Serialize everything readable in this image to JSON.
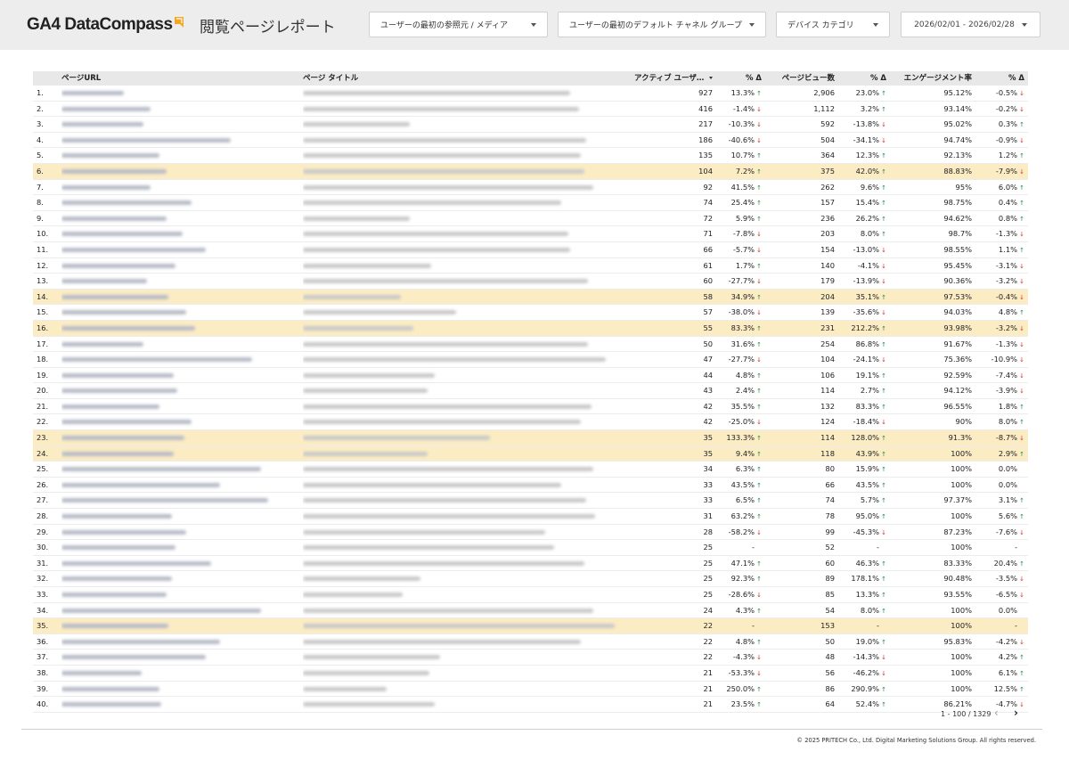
{
  "header": {
    "logo_text": "GA4 DataCompass",
    "page_title": "閲覧ページレポート",
    "filters": {
      "source_medium": "ユーザーの最初の参照元 / メディア",
      "channel_group": "ユーザーの最初のデフォルト チャネル グループ",
      "device": "デバイス カテゴリ",
      "date_range": "2026/02/01 - 2026/02/28"
    },
    "accent_color": "#f5a623"
  },
  "table": {
    "columns": {
      "url": "ページURL",
      "title": "ページ タイトル",
      "active_users": "アクティブ ユーザ…",
      "d1": "% Δ",
      "page_views": "ページビュー数",
      "d2": "% Δ",
      "engagement": "エンゲージメント率",
      "d3": "% Δ"
    },
    "sort_column": "active_users",
    "highlight_color": "#fbecc4",
    "rows": [
      {
        "num": "1.",
        "au": "927",
        "d1": "13.3%",
        "d1t": "up",
        "pv": "2,906",
        "d2": "23.0%",
        "d2t": "up",
        "er": "95.12%",
        "d3": "-0.5%",
        "d3t": "dn",
        "hl": false
      },
      {
        "num": "2.",
        "au": "416",
        "d1": "-1.4%",
        "d1t": "dn",
        "pv": "1,112",
        "d2": "3.2%",
        "d2t": "up",
        "er": "93.14%",
        "d3": "-0.2%",
        "d3t": "dn",
        "hl": false
      },
      {
        "num": "3.",
        "au": "217",
        "d1": "-10.3%",
        "d1t": "dn",
        "pv": "592",
        "d2": "-13.8%",
        "d2t": "dn",
        "er": "95.02%",
        "d3": "0.3%",
        "d3t": "up",
        "hl": false
      },
      {
        "num": "4.",
        "au": "186",
        "d1": "-40.6%",
        "d1t": "dn",
        "pv": "504",
        "d2": "-34.1%",
        "d2t": "dn",
        "er": "94.74%",
        "d3": "-0.9%",
        "d3t": "dn",
        "hl": false
      },
      {
        "num": "5.",
        "au": "135",
        "d1": "10.7%",
        "d1t": "up",
        "pv": "364",
        "d2": "12.3%",
        "d2t": "up",
        "er": "92.13%",
        "d3": "1.2%",
        "d3t": "up",
        "hl": false
      },
      {
        "num": "6.",
        "au": "104",
        "d1": "7.2%",
        "d1t": "up",
        "pv": "375",
        "d2": "42.0%",
        "d2t": "up",
        "er": "88.83%",
        "d3": "-7.9%",
        "d3t": "dn",
        "hl": true
      },
      {
        "num": "7.",
        "au": "92",
        "d1": "41.5%",
        "d1t": "up",
        "pv": "262",
        "d2": "9.6%",
        "d2t": "up",
        "er": "95%",
        "d3": "6.0%",
        "d3t": "up",
        "hl": false
      },
      {
        "num": "8.",
        "au": "74",
        "d1": "25.4%",
        "d1t": "up",
        "pv": "157",
        "d2": "15.4%",
        "d2t": "up",
        "er": "98.75%",
        "d3": "0.4%",
        "d3t": "up",
        "hl": false
      },
      {
        "num": "9.",
        "au": "72",
        "d1": "5.9%",
        "d1t": "up",
        "pv": "236",
        "d2": "26.2%",
        "d2t": "up",
        "er": "94.62%",
        "d3": "0.8%",
        "d3t": "up",
        "hl": false
      },
      {
        "num": "10.",
        "au": "71",
        "d1": "-7.8%",
        "d1t": "dn",
        "pv": "203",
        "d2": "8.0%",
        "d2t": "up",
        "er": "98.7%",
        "d3": "-1.3%",
        "d3t": "dn",
        "hl": false
      },
      {
        "num": "11.",
        "au": "66",
        "d1": "-5.7%",
        "d1t": "dn",
        "pv": "154",
        "d2": "-13.0%",
        "d2t": "dn",
        "er": "98.55%",
        "d3": "1.1%",
        "d3t": "up",
        "hl": false
      },
      {
        "num": "12.",
        "au": "61",
        "d1": "1.7%",
        "d1t": "up",
        "pv": "140",
        "d2": "-4.1%",
        "d2t": "dn",
        "er": "95.45%",
        "d3": "-3.1%",
        "d3t": "dn",
        "hl": false
      },
      {
        "num": "13.",
        "au": "60",
        "d1": "-27.7%",
        "d1t": "dn",
        "pv": "179",
        "d2": "-13.9%",
        "d2t": "dn",
        "er": "90.36%",
        "d3": "-3.2%",
        "d3t": "dn",
        "hl": false
      },
      {
        "num": "14.",
        "au": "58",
        "d1": "34.9%",
        "d1t": "up",
        "pv": "204",
        "d2": "35.1%",
        "d2t": "up",
        "er": "97.53%",
        "d3": "-0.4%",
        "d3t": "dn",
        "hl": true
      },
      {
        "num": "15.",
        "au": "57",
        "d1": "-38.0%",
        "d1t": "dn",
        "pv": "139",
        "d2": "-35.6%",
        "d2t": "dn",
        "er": "94.03%",
        "d3": "4.8%",
        "d3t": "up",
        "hl": false
      },
      {
        "num": "16.",
        "au": "55",
        "d1": "83.3%",
        "d1t": "up",
        "pv": "231",
        "d2": "212.2%",
        "d2t": "up",
        "er": "93.98%",
        "d3": "-3.2%",
        "d3t": "dn",
        "hl": true
      },
      {
        "num": "17.",
        "au": "50",
        "d1": "31.6%",
        "d1t": "up",
        "pv": "254",
        "d2": "86.8%",
        "d2t": "up",
        "er": "91.67%",
        "d3": "-1.3%",
        "d3t": "dn",
        "hl": false
      },
      {
        "num": "18.",
        "au": "47",
        "d1": "-27.7%",
        "d1t": "dn",
        "pv": "104",
        "d2": "-24.1%",
        "d2t": "dn",
        "er": "75.36%",
        "d3": "-10.9%",
        "d3t": "dn",
        "hl": false
      },
      {
        "num": "19.",
        "au": "44",
        "d1": "4.8%",
        "d1t": "up",
        "pv": "106",
        "d2": "19.1%",
        "d2t": "up",
        "er": "92.59%",
        "d3": "-7.4%",
        "d3t": "dn",
        "hl": false
      },
      {
        "num": "20.",
        "au": "43",
        "d1": "2.4%",
        "d1t": "up",
        "pv": "114",
        "d2": "2.7%",
        "d2t": "up",
        "er": "94.12%",
        "d3": "-3.9%",
        "d3t": "dn",
        "hl": false
      },
      {
        "num": "21.",
        "au": "42",
        "d1": "35.5%",
        "d1t": "up",
        "pv": "132",
        "d2": "83.3%",
        "d2t": "up",
        "er": "96.55%",
        "d3": "1.8%",
        "d3t": "up",
        "hl": false
      },
      {
        "num": "22.",
        "au": "42",
        "d1": "-25.0%",
        "d1t": "dn",
        "pv": "124",
        "d2": "-18.4%",
        "d2t": "dn",
        "er": "90%",
        "d3": "8.0%",
        "d3t": "up",
        "hl": false
      },
      {
        "num": "23.",
        "au": "35",
        "d1": "133.3%",
        "d1t": "up",
        "pv": "114",
        "d2": "128.0%",
        "d2t": "up",
        "er": "91.3%",
        "d3": "-8.7%",
        "d3t": "dn",
        "hl": true
      },
      {
        "num": "24.",
        "au": "35",
        "d1": "9.4%",
        "d1t": "up",
        "pv": "118",
        "d2": "43.9%",
        "d2t": "up",
        "er": "100%",
        "d3": "2.9%",
        "d3t": "up",
        "hl": true
      },
      {
        "num": "25.",
        "au": "34",
        "d1": "6.3%",
        "d1t": "up",
        "pv": "80",
        "d2": "15.9%",
        "d2t": "up",
        "er": "100%",
        "d3": "0.0%",
        "d3t": "",
        "hl": false
      },
      {
        "num": "26.",
        "au": "33",
        "d1": "43.5%",
        "d1t": "up",
        "pv": "66",
        "d2": "43.5%",
        "d2t": "up",
        "er": "100%",
        "d3": "0.0%",
        "d3t": "",
        "hl": false
      },
      {
        "num": "27.",
        "au": "33",
        "d1": "6.5%",
        "d1t": "up",
        "pv": "74",
        "d2": "5.7%",
        "d2t": "up",
        "er": "97.37%",
        "d3": "3.1%",
        "d3t": "up",
        "hl": false
      },
      {
        "num": "28.",
        "au": "31",
        "d1": "63.2%",
        "d1t": "up",
        "pv": "78",
        "d2": "95.0%",
        "d2t": "up",
        "er": "100%",
        "d3": "5.6%",
        "d3t": "up",
        "hl": false
      },
      {
        "num": "29.",
        "au": "28",
        "d1": "-58.2%",
        "d1t": "dn",
        "pv": "99",
        "d2": "-45.3%",
        "d2t": "dn",
        "er": "87.23%",
        "d3": "-7.6%",
        "d3t": "dn",
        "hl": false
      },
      {
        "num": "30.",
        "au": "25",
        "d1": "-",
        "d1t": "",
        "pv": "52",
        "d2": "-",
        "d2t": "",
        "er": "100%",
        "d3": "-",
        "d3t": "",
        "hl": false
      },
      {
        "num": "31.",
        "au": "25",
        "d1": "47.1%",
        "d1t": "up",
        "pv": "60",
        "d2": "46.3%",
        "d2t": "up",
        "er": "83.33%",
        "d3": "20.4%",
        "d3t": "up",
        "hl": false
      },
      {
        "num": "32.",
        "au": "25",
        "d1": "92.3%",
        "d1t": "up",
        "pv": "89",
        "d2": "178.1%",
        "d2t": "up",
        "er": "90.48%",
        "d3": "-3.5%",
        "d3t": "dn",
        "hl": false
      },
      {
        "num": "33.",
        "au": "25",
        "d1": "-28.6%",
        "d1t": "dn",
        "pv": "85",
        "d2": "13.3%",
        "d2t": "up",
        "er": "93.55%",
        "d3": "-6.5%",
        "d3t": "dn",
        "hl": false
      },
      {
        "num": "34.",
        "au": "24",
        "d1": "4.3%",
        "d1t": "up",
        "pv": "54",
        "d2": "8.0%",
        "d2t": "up",
        "er": "100%",
        "d3": "0.0%",
        "d3t": "",
        "hl": false
      },
      {
        "num": "35.",
        "au": "22",
        "d1": "-",
        "d1t": "",
        "pv": "153",
        "d2": "-",
        "d2t": "",
        "er": "100%",
        "d3": "-",
        "d3t": "",
        "hl": true
      },
      {
        "num": "36.",
        "au": "22",
        "d1": "4.8%",
        "d1t": "up",
        "pv": "50",
        "d2": "19.0%",
        "d2t": "up",
        "er": "95.83%",
        "d3": "-4.2%",
        "d3t": "dn",
        "hl": false
      },
      {
        "num": "37.",
        "au": "22",
        "d1": "-4.3%",
        "d1t": "dn",
        "pv": "48",
        "d2": "-14.3%",
        "d2t": "dn",
        "er": "100%",
        "d3": "4.2%",
        "d3t": "up",
        "hl": false
      },
      {
        "num": "38.",
        "au": "21",
        "d1": "-53.3%",
        "d1t": "dn",
        "pv": "56",
        "d2": "-46.2%",
        "d2t": "dn",
        "er": "100%",
        "d3": "6.1%",
        "d3t": "up",
        "hl": false
      },
      {
        "num": "39.",
        "au": "21",
        "d1": "250.0%",
        "d1t": "up",
        "pv": "86",
        "d2": "290.9%",
        "d2t": "up",
        "er": "100%",
        "d3": "12.5%",
        "d3t": "up",
        "hl": false
      },
      {
        "num": "40.",
        "au": "21",
        "d1": "23.5%",
        "d1t": "up",
        "pv": "64",
        "d2": "52.4%",
        "d2t": "up",
        "er": "86.21%",
        "d3": "-4.7%",
        "d3t": "dn",
        "hl": false
      }
    ]
  },
  "pagination": {
    "range_text": "1 - 100 / 1329",
    "prev_icon": "‹",
    "next_icon": "›"
  },
  "footer": {
    "copyright": "© 2025 PRITECH Co., Ltd. Digital Marketing Solutions Group. All rights reserved."
  }
}
